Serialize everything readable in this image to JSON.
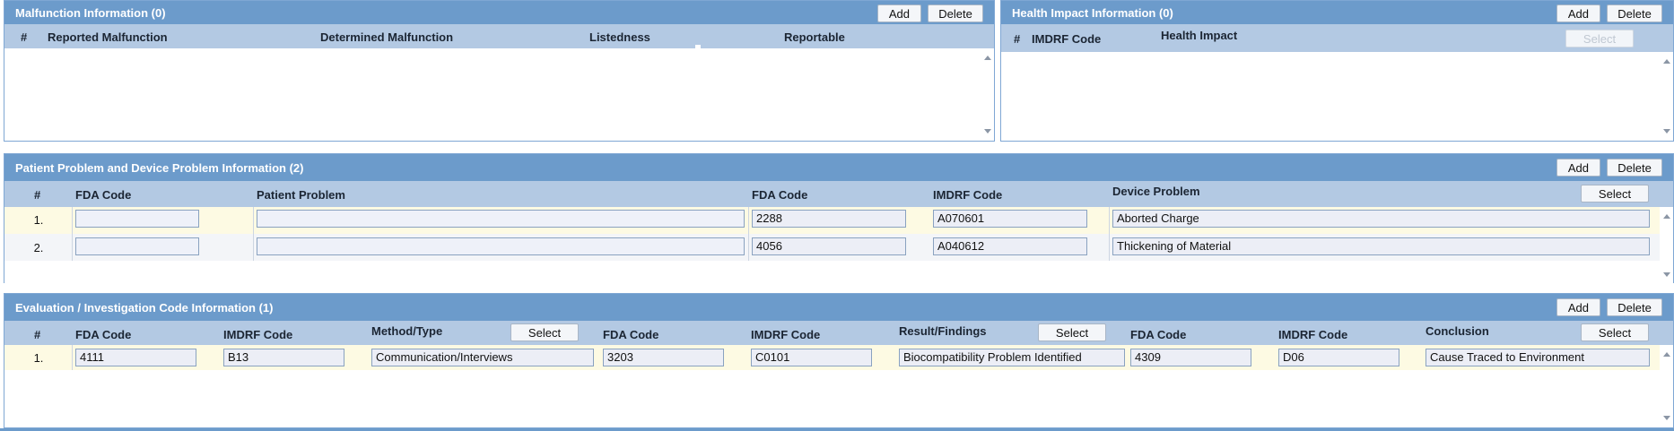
{
  "malfunction": {
    "title": "Malfunction Information (0)",
    "add_label": "Add",
    "delete_label": "Delete",
    "columns": [
      "#",
      "Reported Malfunction",
      "Determined Malfunction",
      "Listedness",
      "Reportable"
    ]
  },
  "health_impact": {
    "title": "Health Impact Information (0)",
    "add_label": "Add",
    "delete_label": "Delete",
    "select_label": "Select",
    "columns": [
      "#",
      "IMDRF Code",
      "Health Impact"
    ]
  },
  "patient_device": {
    "title": "Patient Problem and Device Problem Information (2)",
    "add_label": "Add",
    "delete_label": "Delete",
    "select_label": "Select",
    "columns": [
      "#",
      "FDA Code",
      "Patient Problem",
      "FDA Code",
      "IMDRF Code",
      "Device Problem"
    ],
    "rows": [
      {
        "num": "1.",
        "fda_code_patient": "",
        "patient_problem": "",
        "fda_code_device": "2288",
        "imdrf_code": "A070601",
        "device_problem": "Aborted Charge"
      },
      {
        "num": "2.",
        "fda_code_patient": "",
        "patient_problem": "",
        "fda_code_device": "4056",
        "imdrf_code": "A040612",
        "device_problem": "Thickening of Material"
      }
    ]
  },
  "evaluation": {
    "title": "Evaluation / Investigation Code Information (1)",
    "add_label": "Add",
    "delete_label": "Delete",
    "select_label": "Select",
    "columns": [
      "#",
      "FDA Code",
      "IMDRF Code",
      "Method/Type",
      "FDA Code",
      "IMDRF Code",
      "Result/Findings",
      "FDA Code",
      "IMDRF Code",
      "Conclusion"
    ],
    "rows": [
      {
        "num": "1.",
        "method_fda": "4111",
        "method_imdrf": "B13",
        "method_type": "Communication/Interviews",
        "result_fda": "3203",
        "result_imdrf": "C0101",
        "result_findings": "Biocompatibility Problem Identified",
        "conclusion_fda": "4309",
        "conclusion_imdrf": "D06",
        "conclusion": "Cause Traced to Environment"
      }
    ]
  },
  "colors": {
    "header_bg": "#6c9bcb",
    "column_header_bg": "#b3c9e3",
    "row_highlight": "#fdfae3"
  }
}
